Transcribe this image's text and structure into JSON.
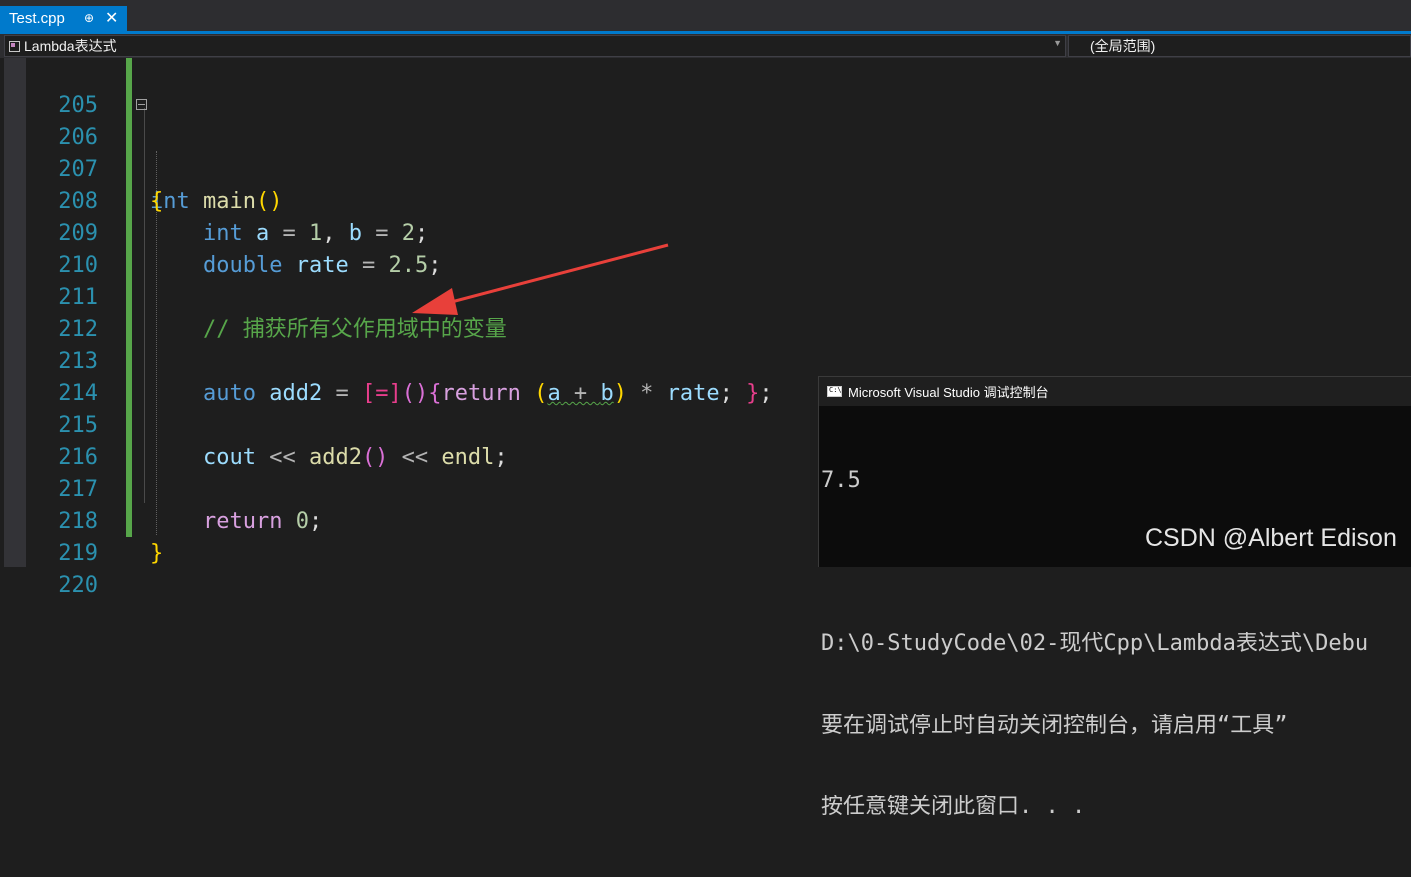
{
  "tab": {
    "label": "Test.cpp",
    "pin": "⊕",
    "close": "✕"
  },
  "navbar": {
    "scope": "Lambda表达式",
    "context": "(全局范围)"
  },
  "editor": {
    "lines": [
      {
        "n": "205"
      },
      {
        "n": "206"
      },
      {
        "n": "207"
      },
      {
        "n": "208"
      },
      {
        "n": "209"
      },
      {
        "n": "210"
      },
      {
        "n": "211"
      },
      {
        "n": "212"
      },
      {
        "n": "213"
      },
      {
        "n": "214"
      },
      {
        "n": "215"
      },
      {
        "n": "216"
      },
      {
        "n": "217"
      },
      {
        "n": "218"
      },
      {
        "n": "219"
      },
      {
        "n": "220"
      }
    ],
    "tokens": {
      "l206": {
        "kw": "int",
        "fn": "main",
        "p": "()"
      },
      "l207": {
        "b": "{"
      },
      "l208": {
        "kw": "int",
        "rest1": "a",
        "eq": " = ",
        "n1": "1",
        "c": ", ",
        "v2": "b",
        "eq2": " = ",
        "n2": "2",
        "semi": ";"
      },
      "l209": {
        "kw": "double",
        "v": "rate",
        "eq": " = ",
        "n": "2.5",
        "semi": ";"
      },
      "l211": {
        "cmt": "// 捕获所有父作用域中的变量"
      },
      "l213": {
        "kw": "auto",
        "fn": "add2",
        "eq": " = ",
        "cap": "[=]",
        "paren": "()",
        "ob": "{",
        "ret": "return",
        "lp": " (",
        "a": "a",
        "plus": " + ",
        "b": "b",
        "rp": ")",
        "mul": " * ",
        "rate": "rate",
        "semi": "; ",
        "cb": "}",
        "end": ";"
      },
      "l215": {
        "v": "cout",
        "op1": " << ",
        "fn": "add2",
        "p": "()",
        "op2": " << ",
        "endl": "endl",
        "semi": ";"
      },
      "l217": {
        "ret": "return",
        "n": " 0",
        "semi": ";"
      },
      "l218": {
        "b": "}"
      }
    }
  },
  "console": {
    "title": "Microsoft Visual Studio 调试控制台",
    "lines": [
      "7.5",
      "",
      "D:\\0-StudyCode\\02-现代Cpp\\Lambda表达式\\Debu",
      "要在调试停止时自动关闭控制台，请启用“工具”",
      "按任意键关闭此窗口. . ."
    ]
  },
  "watermark": "CSDN @Albert Edison",
  "colors": {
    "accent": "#007acc",
    "arrow": "#e8403a"
  }
}
